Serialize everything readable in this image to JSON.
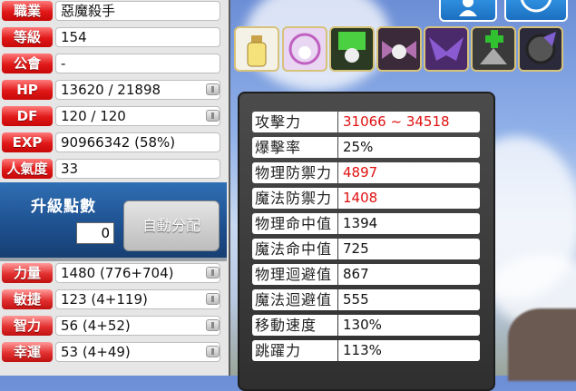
{
  "character": {
    "rows": [
      {
        "label": "職業",
        "value": "惡魔殺手"
      },
      {
        "label": "等級",
        "value": "154"
      },
      {
        "label": "公會",
        "value": "-"
      },
      {
        "label": "HP",
        "value": "13620 / 21898"
      },
      {
        "label": "DF",
        "value": "120 / 120"
      },
      {
        "label": "EXP",
        "value": "90966342 (58%)"
      },
      {
        "label": "人氣度",
        "value": "33"
      }
    ],
    "ap_title": "升級點數",
    "ap_value": "0",
    "auto_assign": "自動分配",
    "stats": [
      {
        "label": "力量",
        "value": "1480 (776+704)"
      },
      {
        "label": "敏捷",
        "value": "123 (4+119)"
      },
      {
        "label": "智力",
        "value": "56 (4+52)"
      },
      {
        "label": "幸運",
        "value": "53 (4+49)"
      }
    ]
  },
  "detail": {
    "rows": [
      {
        "label": "攻擊力",
        "value": "31066 ~ 34518",
        "highlight": true
      },
      {
        "label": "爆擊率",
        "value": "25%",
        "highlight": false
      },
      {
        "label": "物理防禦力",
        "value": "4897",
        "highlight": true
      },
      {
        "label": "魔法防禦力",
        "value": "1408",
        "highlight": true
      },
      {
        "label": "物理命中值",
        "value": "1394",
        "highlight": false
      },
      {
        "label": "魔法命中值",
        "value": "725",
        "highlight": false
      },
      {
        "label": "物理迴避值",
        "value": "867",
        "highlight": false
      },
      {
        "label": "魔法迴避值",
        "value": "555",
        "highlight": false
      },
      {
        "label": "移動速度",
        "value": "130%",
        "highlight": false
      },
      {
        "label": "跳躍力",
        "value": "113%",
        "highlight": false
      }
    ]
  },
  "buffs": [
    "potion-buff-icon",
    "crest-buff-icon",
    "green-skull-buff-icon",
    "winged-skull-buff-icon",
    "dark-wings-buff-icon",
    "cross-buff-icon",
    "dark-orb-buff-icon"
  ],
  "colors": {
    "label_red": "#e01818",
    "value_red": "#e01010",
    "panel_dark": "#3a3a3a",
    "ap_blue": "#1d4f8e"
  }
}
